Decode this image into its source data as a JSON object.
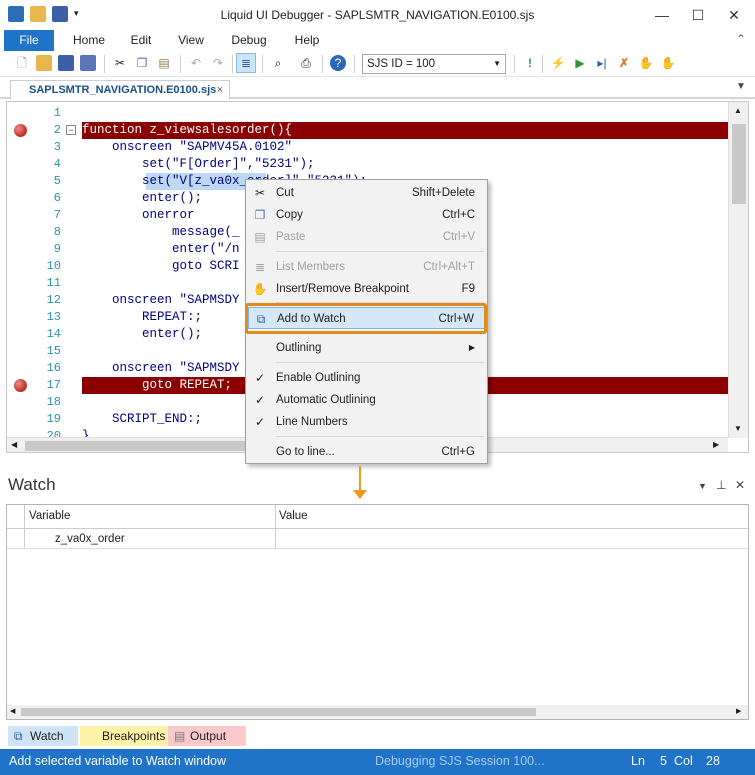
{
  "window": {
    "title": "Liquid UI Debugger - SAPLSMTR_NAVIGATION.E0100.sjs",
    "controls": [
      "minimize-icon",
      "maximize-icon",
      "close-icon"
    ]
  },
  "menubar": {
    "items": [
      "File",
      "Home",
      "Edit",
      "View",
      "Debug",
      "Help"
    ]
  },
  "toolbar": {
    "sjs_select_value": "SJS ID = 100"
  },
  "tabs": {
    "active": "SAPLSMTR_NAVIGATION.E0100.sjs",
    "close": "×"
  },
  "editor": {
    "lines": [
      {
        "n": "1",
        "text": "",
        "bp": false
      },
      {
        "n": "2",
        "text": "function z_viewsalesorder(){",
        "bp": true
      },
      {
        "n": "3",
        "text": "    onscreen \"SAPMV45A.0102\"",
        "bp": false
      },
      {
        "n": "4",
        "text": "        set(\"F[Order]\",\"5231\");",
        "bp": false
      },
      {
        "n": "5",
        "text": "        set(\"V[z_va0x_order]\",\"5231\");",
        "bp": false
      },
      {
        "n": "6",
        "text": "        enter();",
        "bp": false
      },
      {
        "n": "7",
        "text": "        onerror",
        "bp": false
      },
      {
        "n": "8",
        "text": "            message(_",
        "bp": false
      },
      {
        "n": "9",
        "text": "            enter(\"/n",
        "bp": false
      },
      {
        "n": "10",
        "text": "            goto SCRI",
        "bp": false
      },
      {
        "n": "11",
        "text": "",
        "bp": false
      },
      {
        "n": "12",
        "text": "    onscreen \"SAPMSDY",
        "bp": false
      },
      {
        "n": "13",
        "text": "        REPEAT:;",
        "bp": false
      },
      {
        "n": "14",
        "text": "        enter();",
        "bp": false
      },
      {
        "n": "15",
        "text": "",
        "bp": false
      },
      {
        "n": "16",
        "text": "    onscreen \"SAPMSDY",
        "bp": false
      },
      {
        "n": "17",
        "text": "        goto REPEAT;",
        "bp": true
      },
      {
        "n": "18",
        "text": "",
        "bp": false
      },
      {
        "n": "19",
        "text": "    SCRIPT_END:;",
        "bp": false
      },
      {
        "n": "20",
        "text": "}",
        "bp": false
      }
    ],
    "selection": "z_va0x_order"
  },
  "context_menu": {
    "items": [
      {
        "label": "Cut",
        "shortcut": "Shift+Delete",
        "icon": "scissors-icon",
        "enabled": true
      },
      {
        "label": "Copy",
        "shortcut": "Ctrl+C",
        "icon": "copy-icon",
        "enabled": true
      },
      {
        "label": "Paste",
        "shortcut": "Ctrl+V",
        "icon": "paste-icon",
        "enabled": false
      },
      {
        "label": "List Members",
        "shortcut": "Ctrl+Alt+T",
        "icon": "list-icon",
        "enabled": false
      },
      {
        "label": "Insert/Remove Breakpoint",
        "shortcut": "F9",
        "icon": "hand-icon",
        "enabled": true
      },
      {
        "label": "Add to Watch",
        "shortcut": "Ctrl+W",
        "icon": "watch-icon",
        "enabled": true
      },
      {
        "label": "Outlining",
        "shortcut": "",
        "icon": "",
        "enabled": true
      },
      {
        "label": "Enable Outlining",
        "shortcut": "",
        "icon": "check-icon",
        "enabled": true
      },
      {
        "label": "Automatic Outlining",
        "shortcut": "",
        "icon": "check-icon",
        "enabled": true
      },
      {
        "label": "Line Numbers",
        "shortcut": "",
        "icon": "check-icon",
        "enabled": true
      },
      {
        "label": "Go to line...",
        "shortcut": "Ctrl+G",
        "icon": "",
        "enabled": true
      }
    ]
  },
  "watch": {
    "title": "Watch",
    "columns": [
      "Variable",
      "Value"
    ],
    "rows": [
      {
        "variable": "z_va0x_order",
        "value": ""
      }
    ]
  },
  "bottom_tabs": [
    "Watch",
    "Breakpoints",
    "Output"
  ],
  "status": {
    "message": "Add selected variable to Watch window",
    "session": "Debugging SJS Session 100...",
    "ln_label": "Ln",
    "ln": "5",
    "col_label": "Col",
    "col": "28"
  },
  "colors": {
    "accent": "#1f73c9",
    "breakpoint_line": "#8b0000",
    "highlight": "#e08b15"
  }
}
